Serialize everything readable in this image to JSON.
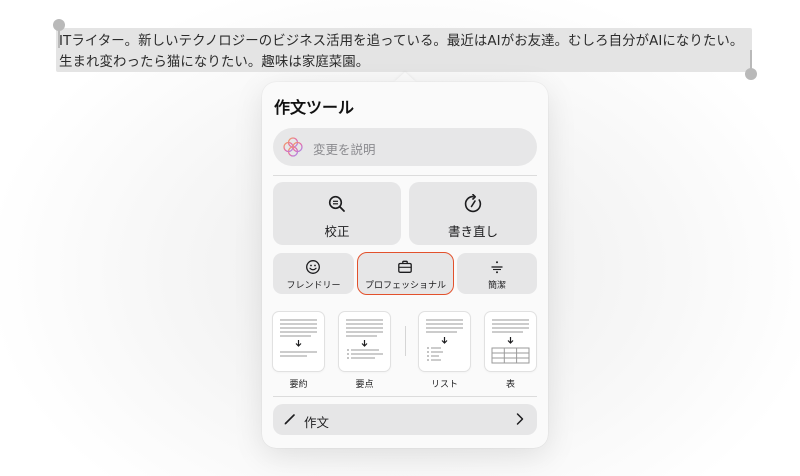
{
  "document": {
    "paragraph": "ITライター。新しいテクノロジーのビジネス活用を追っている。最近はAIがお友達。むしろ自分がAIになりたい。生まれ変わったら猫になりたい。趣味は家庭菜園。"
  },
  "writing_tools": {
    "title": "作文ツール",
    "describe_placeholder": "変更を説明",
    "proofread_label": "校正",
    "rewrite_label": "書き直し",
    "tones": [
      {
        "label": "フレンドリー",
        "icon": "smiley-icon"
      },
      {
        "label": "プロフェッショナル",
        "icon": "briefcase-icon",
        "selected": true
      },
      {
        "label": "簡潔",
        "icon": "divide-icon"
      }
    ],
    "formats": [
      {
        "label": "要約",
        "icon": "summary-doc-icon"
      },
      {
        "label": "要点",
        "icon": "bullets-doc-icon"
      },
      {
        "label": "リスト",
        "icon": "list-doc-icon"
      },
      {
        "label": "表",
        "icon": "table-doc-icon"
      }
    ],
    "compose_label": "作文"
  },
  "colors": {
    "selected_outline": "#e2512c",
    "ai_icon_gradient": [
      "#f3a25c",
      "#e56aa8",
      "#a78bf0"
    ]
  }
}
